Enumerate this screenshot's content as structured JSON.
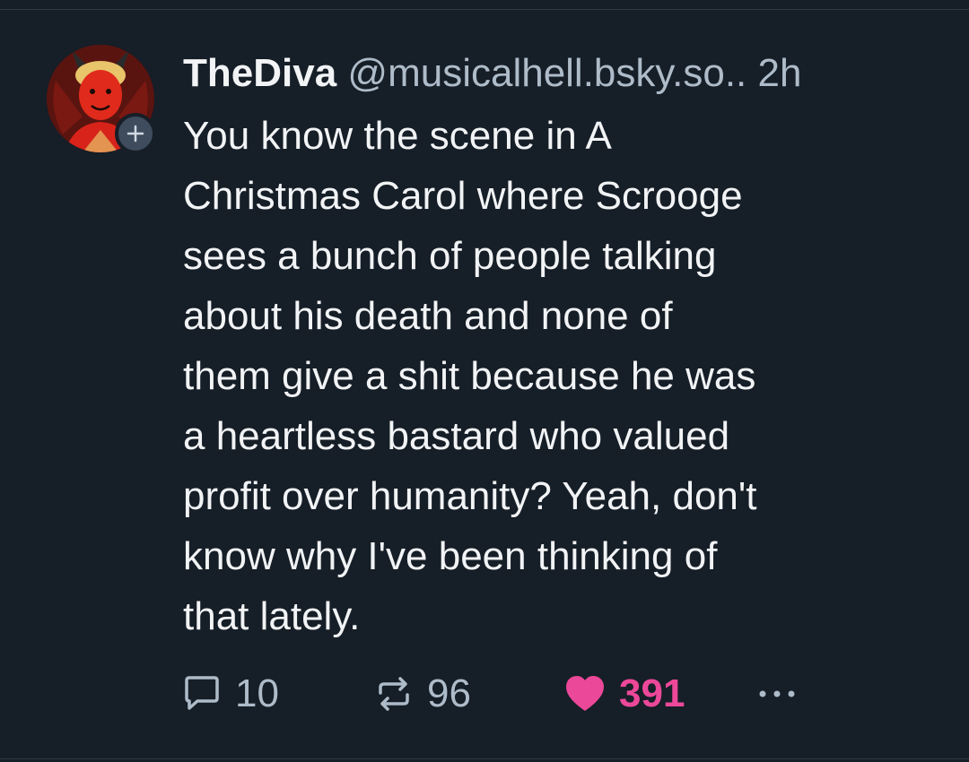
{
  "post": {
    "author": {
      "display_name": "TheDiva",
      "handle": "@musicalhell.bsky.so..",
      "avatar_icon": "devil-avatar-icon"
    },
    "time_ago": "2h",
    "text": "You know the scene in A\nChristmas Carol where Scrooge\nsees a bunch of people talking\nabout his death and none of\nthem give a shit because he was\na heartless bastard who valued\nprofit over humanity? Yeah, don't\nknow why I've been thinking of\nthat lately.",
    "actions": {
      "replies": "10",
      "reposts": "96",
      "likes": "391"
    }
  },
  "colors": {
    "background": "#161e27",
    "text": "#f1f3f5",
    "muted": "#aebbc9",
    "like": "#ec4899"
  }
}
